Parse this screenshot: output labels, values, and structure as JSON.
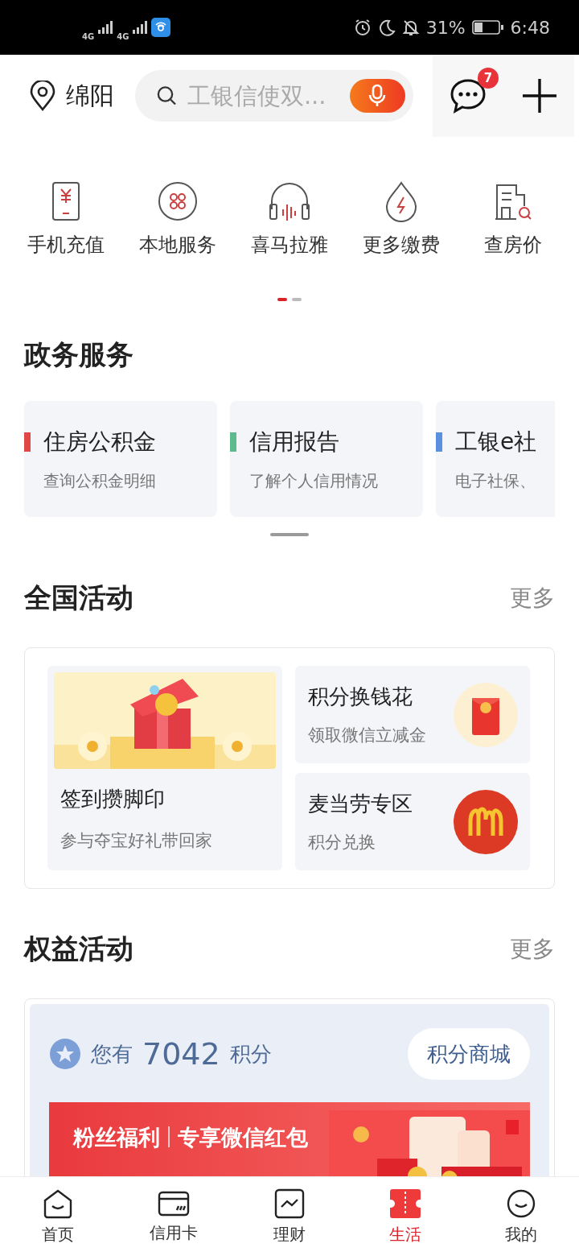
{
  "status_bar": {
    "network_1": "4G",
    "network_2": "4G",
    "battery": "31%",
    "time": "6:48"
  },
  "header": {
    "location": "绵阳",
    "search": {
      "placeholder": "工银信使双..."
    },
    "message_badge": "7"
  },
  "quick_services": {
    "items": [
      {
        "label": "手机充值"
      },
      {
        "label": "本地服务"
      },
      {
        "label": "喜马拉雅"
      },
      {
        "label": "更多缴费"
      },
      {
        "label": "查房价"
      }
    ],
    "pages": [
      {
        "selected": true
      },
      {
        "selected": false
      }
    ]
  },
  "gov_services": {
    "title": "政务服务",
    "cards": [
      {
        "title": "住房公积金",
        "subtitle": "查询公积金明细",
        "color": "#e04848"
      },
      {
        "title": "信用报告",
        "subtitle": "了解个人信用情况",
        "color": "#5cba8c"
      },
      {
        "title": "工银e社",
        "subtitle": "电子社保、",
        "color": "#5b8fe0"
      }
    ]
  },
  "national_activities": {
    "title": "全国活动",
    "more": "更多",
    "featured": {
      "title": "签到攒脚印",
      "subtitle": "参与夺宝好礼带回家"
    },
    "tiles": [
      {
        "title": "积分换钱花",
        "subtitle": "领取微信立减金"
      },
      {
        "title": "麦当劳专区",
        "subtitle": "积分兑换"
      }
    ]
  },
  "rights_activities": {
    "title": "权益活动",
    "more": "更多",
    "points": {
      "prefix": "您有",
      "value": "7042",
      "unit": "积分"
    },
    "mall_button": "积分商城",
    "banner": {
      "title": "粉丝福利",
      "subtitle": "专享微信红包"
    }
  },
  "tab_bar": [
    {
      "label": "首页",
      "selected": false
    },
    {
      "label": "信用卡",
      "selected": false
    },
    {
      "label": "理财",
      "selected": false
    },
    {
      "label": "生活",
      "selected": true
    },
    {
      "label": "我的",
      "selected": false
    }
  ]
}
